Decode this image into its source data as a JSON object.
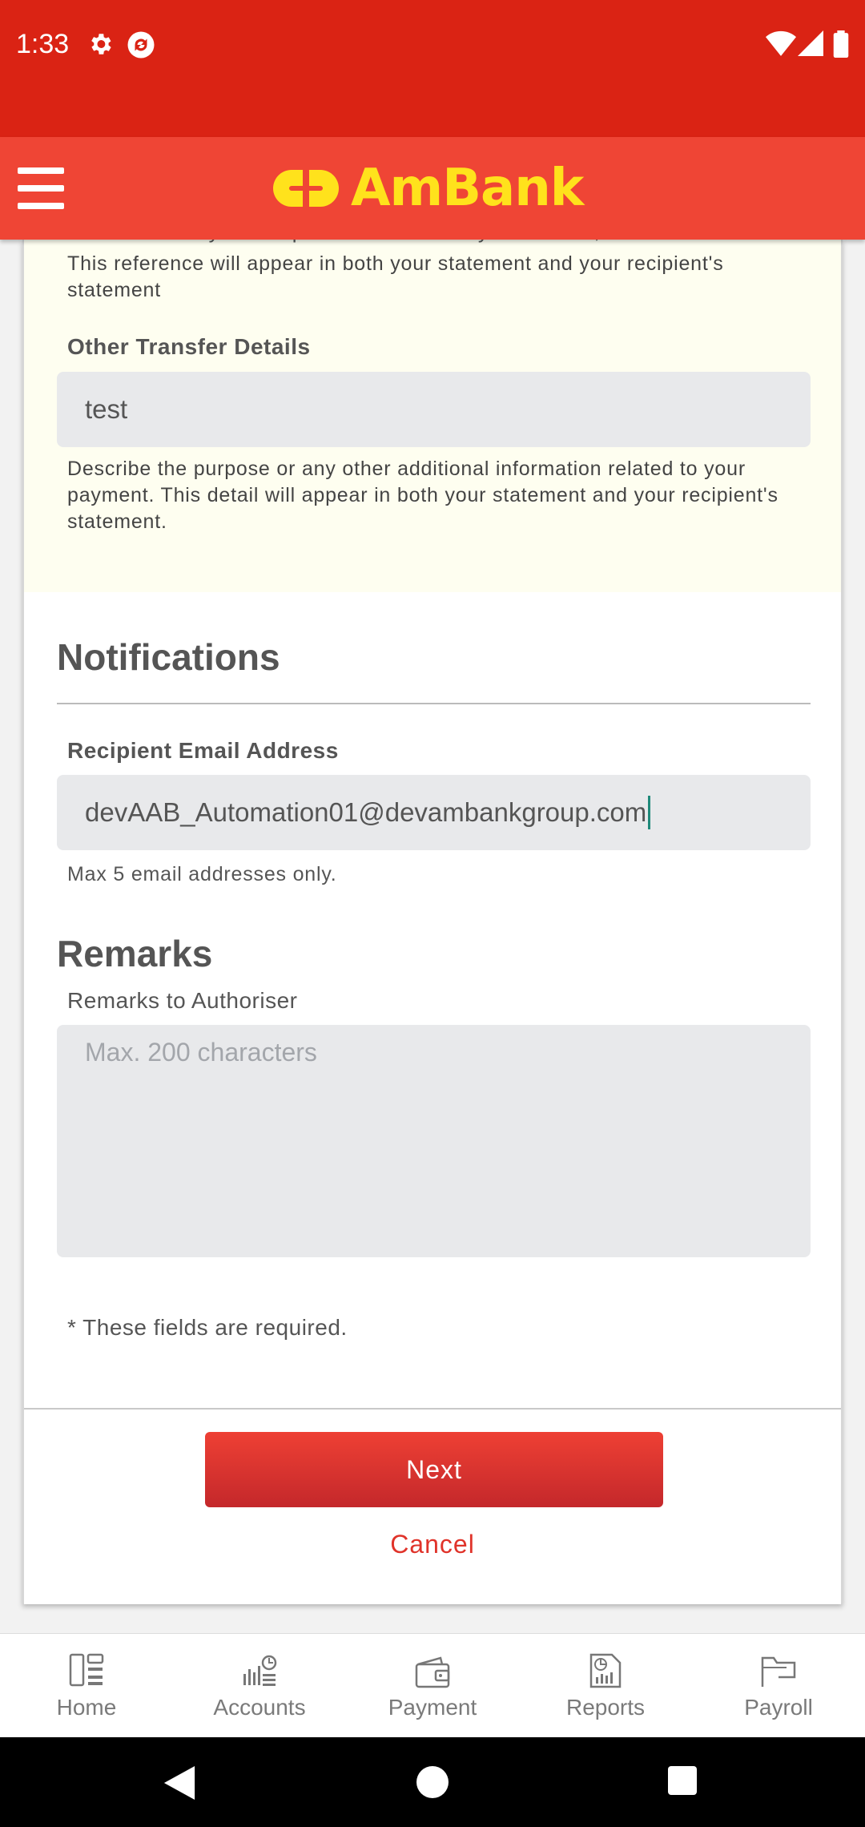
{
  "status_bar": {
    "time": "1:33",
    "icons": [
      "settings-icon",
      "sync-icon",
      "wifi-icon",
      "signal-icon",
      "battery-icon"
    ]
  },
  "header": {
    "brand": "AmBank",
    "brand_color": "#ffe21c",
    "bar_color": "#ef4535"
  },
  "form": {
    "clipped_text": "A reference to your recipient which can be your invoice, bill no. etc.",
    "reference_help": "This reference will appear in both your statement and your recipient's statement",
    "other_details": {
      "label": "Other Transfer Details",
      "value": "test",
      "help": "Describe the purpose or any other additional information related to your payment. This detail will appear in both your statement and your recipient's statement."
    },
    "notifications": {
      "title": "Notifications",
      "email_label": "Recipient Email Address",
      "email_value": "devAAB_Automation01@devambankgroup.com",
      "email_help": "Max 5 email addresses only."
    },
    "remarks": {
      "title": "Remarks",
      "label": "Remarks to Authoriser",
      "placeholder": "Max. 200 characters"
    },
    "required_note": "* These fields are required.",
    "next_label": "Next",
    "cancel_label": "Cancel"
  },
  "bottom_nav": {
    "items": [
      {
        "label": "Home",
        "icon": "home-icon"
      },
      {
        "label": "Accounts",
        "icon": "accounts-icon"
      },
      {
        "label": "Payment",
        "icon": "wallet-icon"
      },
      {
        "label": "Reports",
        "icon": "reports-icon"
      },
      {
        "label": "Payroll",
        "icon": "payroll-icon"
      }
    ]
  }
}
